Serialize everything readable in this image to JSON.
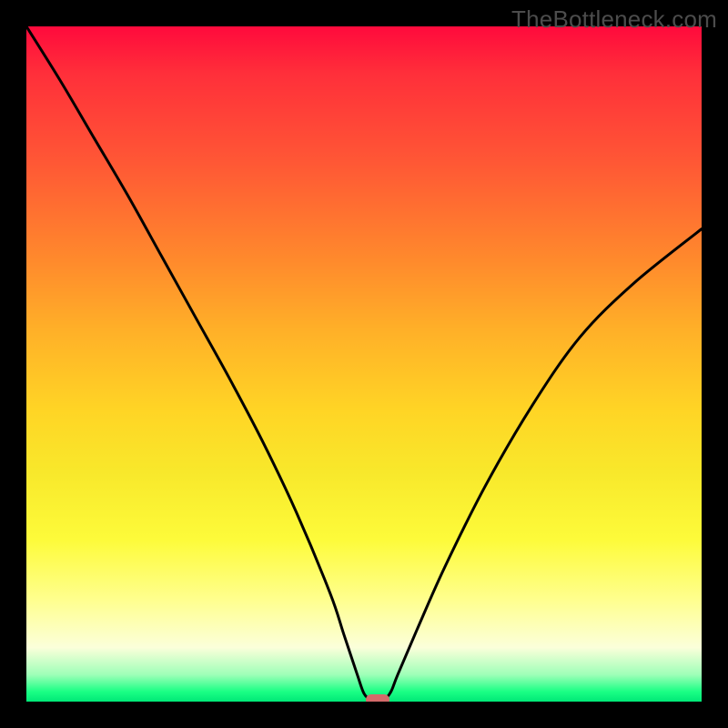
{
  "watermark": "TheBottleneck.com",
  "chart_data": {
    "type": "line",
    "title": "",
    "xlabel": "",
    "ylabel": "",
    "xlim": [
      0,
      100
    ],
    "ylim": [
      0,
      100
    ],
    "x": [
      0,
      5,
      10,
      15,
      20,
      25,
      30,
      35,
      40,
      45,
      47,
      49,
      50,
      51,
      52,
      53,
      54,
      55,
      58,
      62,
      68,
      75,
      82,
      90,
      100
    ],
    "values": [
      100,
      92,
      83.5,
      75,
      66,
      57,
      48,
      38.5,
      28,
      16,
      10,
      4,
      1.2,
      0.3,
      0.3,
      0.3,
      1.5,
      4,
      11,
      20,
      32,
      44,
      54,
      62,
      70
    ],
    "min_point": {
      "x": 52,
      "y": 0.3
    },
    "marker_color": "#d46a6a",
    "curve_color": "#000000",
    "gradient_stops": [
      {
        "pos": 0,
        "color": "#ff0a3c"
      },
      {
        "pos": 7,
        "color": "#ff2f3a"
      },
      {
        "pos": 20,
        "color": "#ff5735"
      },
      {
        "pos": 35,
        "color": "#ff8b2c"
      },
      {
        "pos": 45,
        "color": "#ffb028"
      },
      {
        "pos": 57,
        "color": "#ffd525"
      },
      {
        "pos": 66,
        "color": "#f8e82b"
      },
      {
        "pos": 76,
        "color": "#fdfb3a"
      },
      {
        "pos": 85,
        "color": "#ffff8f"
      },
      {
        "pos": 92,
        "color": "#fbffda"
      },
      {
        "pos": 96,
        "color": "#9fffb8"
      },
      {
        "pos": 98.5,
        "color": "#1bff85"
      },
      {
        "pos": 100,
        "color": "#00e877"
      }
    ]
  }
}
